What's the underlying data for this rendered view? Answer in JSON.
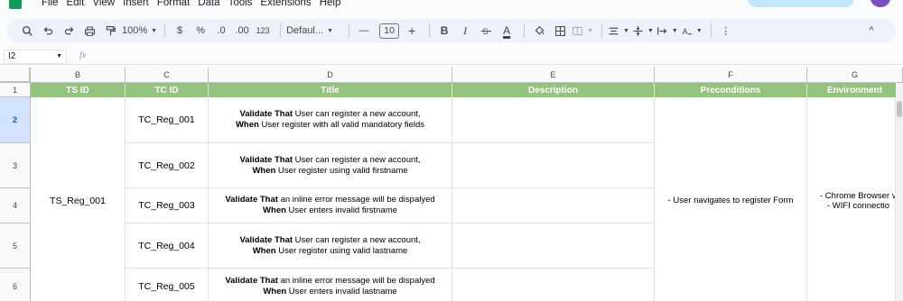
{
  "menu": [
    "File",
    "Edit",
    "View",
    "Insert",
    "Format",
    "Data",
    "Tools",
    "Extensions",
    "Help"
  ],
  "toolbar": {
    "zoom": "100%",
    "currency": "$",
    "percent": "%",
    "dec_decrease": ".0",
    "dec_increase": ".00",
    "number_format": "123",
    "font": "Defaul...",
    "font_size": "10",
    "minus": "—",
    "plus": "+",
    "bold": "B",
    "italic": "I",
    "text_color": "A",
    "more": "⋮",
    "collapse": "^"
  },
  "formula_bar": {
    "name_box": "I2",
    "fx": "fx",
    "value": ""
  },
  "columns": [
    "B",
    "C",
    "D",
    "E",
    "F",
    "G"
  ],
  "rows": [
    "1",
    "2",
    "3",
    "4",
    "5",
    "6"
  ],
  "selected_row": "2",
  "headers": {
    "ts_id": "TS ID",
    "tc_id": "TC ID",
    "title": "Title",
    "description": "Description",
    "preconditions": "Preconditions",
    "environment": "Environment"
  },
  "ts_id_value": "TS_Reg_001",
  "preconditions_value": "- User navigates to register Form",
  "environment_value": "- Chrome Browser v\n   - WIFI connectio",
  "test_cases": [
    {
      "tc_id": "TC_Reg_001",
      "kw1": "Validate That",
      "line1": " User can register a new account,",
      "kw2": "When",
      "line2": " User register with all valid mandatory fields"
    },
    {
      "tc_id": "TC_Reg_002",
      "kw1": "Validate That",
      "line1": " User can register a new account,",
      "kw2": "When",
      "line2": " User register using valid firstname"
    },
    {
      "tc_id": "TC_Reg_003",
      "kw1": "Validate That",
      "line1": " an inline error message will be dispalyed",
      "kw2": "When",
      "line2": " User enters invalid firstname"
    },
    {
      "tc_id": "TC_Reg_004",
      "kw1": "Validate That",
      "line1": " User can register a new account,",
      "kw2": "When",
      "line2": " User register using valid lastname"
    },
    {
      "tc_id": "TC_Reg_005",
      "kw1": "Validate That",
      "line1": " an inline error message will be dispalyed",
      "kw2": "When",
      "line2": " User enters invalid lastname"
    }
  ],
  "colors": {
    "header_green": "#93c47d",
    "selection": "#d3e3fd",
    "sheets_green": "#0f9d58"
  }
}
